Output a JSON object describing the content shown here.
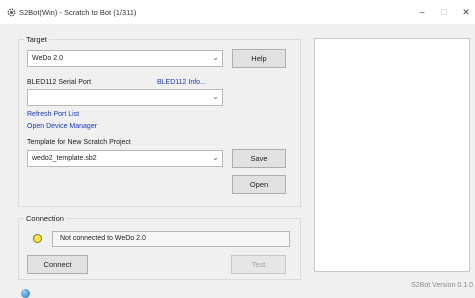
{
  "window": {
    "title": "S2Bot(Win) - Scratch to Bot (1/311)",
    "minimize_glyph": "–",
    "maximize_glyph": "□",
    "close_glyph": "✕"
  },
  "target_group": {
    "label": "Target",
    "target_value": "WeDo 2.0",
    "help_label": "Help",
    "serial_port_label": "BLED112 Serial Port",
    "bled_info_link": "BLED112 Info...",
    "serial_port_value": "",
    "refresh_link": "Refresh Port List",
    "device_manager_link": "Open Device Manager",
    "template_label": "Template for New Scratch Project",
    "template_value": "wedo2_template.sb2",
    "save_label": "Save",
    "open_label": "Open"
  },
  "connection_group": {
    "label": "Connection",
    "status_text": "Not connected to WeDo 2.0",
    "status_led_color": "#f7e84a",
    "connect_label": "Connect",
    "test_label": "Test"
  },
  "version_text": "S2Bot Version 0.1.0",
  "icons": {
    "app": "gear-icon",
    "dropdown": "chevron-down-icon",
    "taskbar": "globe-icon"
  },
  "colors": {
    "link": "#1a35c7",
    "panel_bg": "#f0f0f0"
  }
}
